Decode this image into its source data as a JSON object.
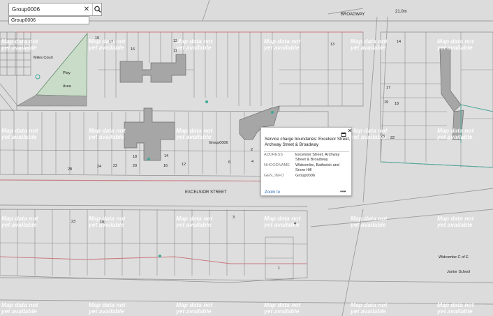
{
  "search": {
    "value": "Group0006",
    "suggestion": "Group0006",
    "clear_glyph": "✕",
    "search_icon": "magnifier-icon"
  },
  "watermark": {
    "line1": "Map data not",
    "line2": "yet available"
  },
  "labels": {
    "broadway": "BROADWAY",
    "level": "21.0m",
    "miles_court": "Miles Court",
    "play": "Play",
    "area": "Area",
    "group": "Group0006",
    "excelsior": "EXCELSIOR STREET",
    "widcombe": "Widcombe C of E",
    "junior_school": "Junior School"
  },
  "house_numbers": {
    "n19": "19",
    "n17": "17",
    "n16": "16",
    "n13a": "13",
    "n11": "11",
    "n13b": "13",
    "n14a": "14",
    "n17b": "17",
    "n19b": "19",
    "n18a": "18",
    "n23a": "23",
    "n22": "22",
    "n18b": "18",
    "n14b": "14",
    "n20": "20",
    "n16b": "16",
    "n12": "12",
    "n22b": "22",
    "n24": "24",
    "n28": "28",
    "n6": "6",
    "n4": "4",
    "n2": "2",
    "n23b": "23",
    "n19c": "19",
    "n3": "3",
    "n4b": "4",
    "n1": "1"
  },
  "popup": {
    "title": "Service charge boundaries: Excelsior Street, Archway Street & Broadway",
    "close_glyph": "✕",
    "rows": [
      {
        "key": "ADDRESS",
        "value": "Excelsior Street, Archway Street & Broadway"
      },
      {
        "key": "NHOODNAME",
        "value": "Widcombe, Bathwick and Snow Hill"
      },
      {
        "key": "GEN_INFO",
        "value": "Group0006"
      }
    ],
    "zoom_label": "Zoom to",
    "more_label": "•••"
  },
  "colors": {
    "background": "#dcdcdc",
    "parcel_line": "#8a8a8a",
    "road": "#d4d4d4",
    "building": "#a6a6a6",
    "boundary_red": "#c9797d",
    "boundary_teal": "#55a89e",
    "play_area": "#c8dcc8",
    "link": "#2a66b5"
  }
}
